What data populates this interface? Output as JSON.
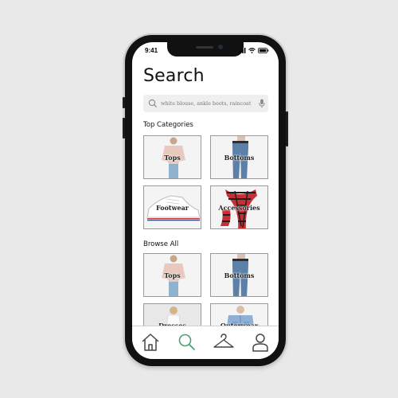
{
  "status_bar": {
    "time": "9:41"
  },
  "header": {
    "title": "Search"
  },
  "search": {
    "placeholder": "white blouse, ankle boots, raincoat"
  },
  "sections": [
    {
      "title": "Top Categories",
      "tiles": [
        {
          "label": "Tops",
          "image": "blouse-photo"
        },
        {
          "label": "Bottoms",
          "image": "jeans-photo"
        },
        {
          "label": "Footwear",
          "image": "sneaker-photo"
        },
        {
          "label": "Accessories",
          "image": "plaid-scarf-photo"
        }
      ]
    },
    {
      "title": "Browse All",
      "tiles": [
        {
          "label": "Tops",
          "image": "blouse-photo"
        },
        {
          "label": "Bottoms",
          "image": "jeans-photo"
        },
        {
          "label": "Dresses",
          "image": "dress-photo"
        },
        {
          "label": "Outerwear",
          "image": "denim-jacket-photo"
        }
      ]
    }
  ],
  "tab_bar": {
    "items": [
      {
        "icon": "home-icon"
      },
      {
        "icon": "search-icon",
        "active": true
      },
      {
        "icon": "hanger-icon"
      },
      {
        "icon": "profile-icon"
      }
    ]
  },
  "colors": {
    "active_tab": "#4f9e74",
    "inactive_tab": "#444444"
  }
}
